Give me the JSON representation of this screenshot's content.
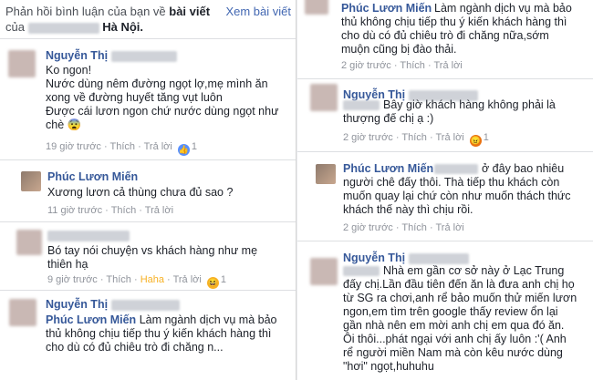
{
  "left": {
    "header": {
      "prefix": "Phản hồi bình luận của bạn về",
      "post": "bài viết",
      "of": "của",
      "location": "Hà Nội.",
      "see_post": "Xem bài viết"
    },
    "comments": [
      {
        "name": "Nguyễn Thị",
        "lines": [
          "Ko ngon!",
          "Nước dùng nêm đường ngọt lợ,mẹ mình ăn",
          "xong về đường huyết tăng vụt luôn",
          "Được cái lươn ngon chứ nước dùng ngọt như",
          "chè 😨"
        ],
        "time": "19 giờ trước",
        "like": "Thích",
        "reply": "Trả lời",
        "reaction_count": "1"
      },
      {
        "name": "Phúc Lươn Miến",
        "lines": [
          "Xương lươn cả thùng chưa đủ sao ?"
        ],
        "time": "11 giờ trước",
        "like": "Thích",
        "reply": "Trả lời"
      },
      {
        "name": "",
        "lines": [
          "Bó tay nói chuyện vs khách hàng như mẹ",
          "thiên hạ"
        ],
        "time": "9 giờ trước",
        "like": "Thích",
        "reaction_text": "Haha",
        "reply": "Trả lời",
        "reaction_count": "1"
      },
      {
        "name": "Nguyễn Thị",
        "reply_name": "Phúc Lươn Miến",
        "lines": [
          "Làm ngành dịch vụ mà bảo",
          "thủ không chịu tiếp thu ý kiến khách hàng thì",
          "cho dù có đủ chiêu trò đi chăng n..."
        ]
      }
    ]
  },
  "right": {
    "comments": [
      {
        "name": "Phúc Lươn Miến",
        "lines": [
          "Làm ngành dịch vụ mà bảo",
          "thủ không chịu tiếp thu ý kiến khách hàng thì",
          "cho dù có đủ chiêu trò đi chăng nữa,sớm",
          "muộn cũng bị đào thải."
        ],
        "time": "2 giờ trước",
        "like": "Thích",
        "reply": "Trả lời"
      },
      {
        "name": "Nguyễn Thị",
        "lines": [
          "Bây giờ khách hàng không phải là",
          "thượng đế chị ạ :)"
        ],
        "time": "2 giờ trước",
        "like": "Thích",
        "reply": "Trả lời",
        "reaction_count": "1"
      },
      {
        "name": "Phúc Lươn Miến",
        "lines": [
          "ở đây bao nhiêu",
          "người chê đấy thôi. Thà tiếp thu khách còn",
          "muốn quay lại chứ còn như muốn thách thức",
          "khách thế này thì chịu rồi."
        ],
        "time": "2 giờ trước",
        "like": "Thích",
        "reply": "Trả lời"
      },
      {
        "name": "Nguyễn Thị",
        "lines": [
          "Nhà em gần cơ sở này ở Lạc Trung",
          "đấy chị.Lần đầu tiên đến ăn là đưa anh chị họ",
          "từ SG ra chơi,anh rể bảo muốn thử miến lươn",
          "ngon,em tìm trên google thấy review ổn lại",
          "gần nhà nên em mời anh chị em qua đó ăn.",
          "Ôi thôi...phát ngại với anh chị ấy luôn :'( Anh",
          "rể người miền Nam mà còn kêu nước dùng",
          "\"hơi\" ngọt,huhuhu"
        ]
      }
    ]
  }
}
